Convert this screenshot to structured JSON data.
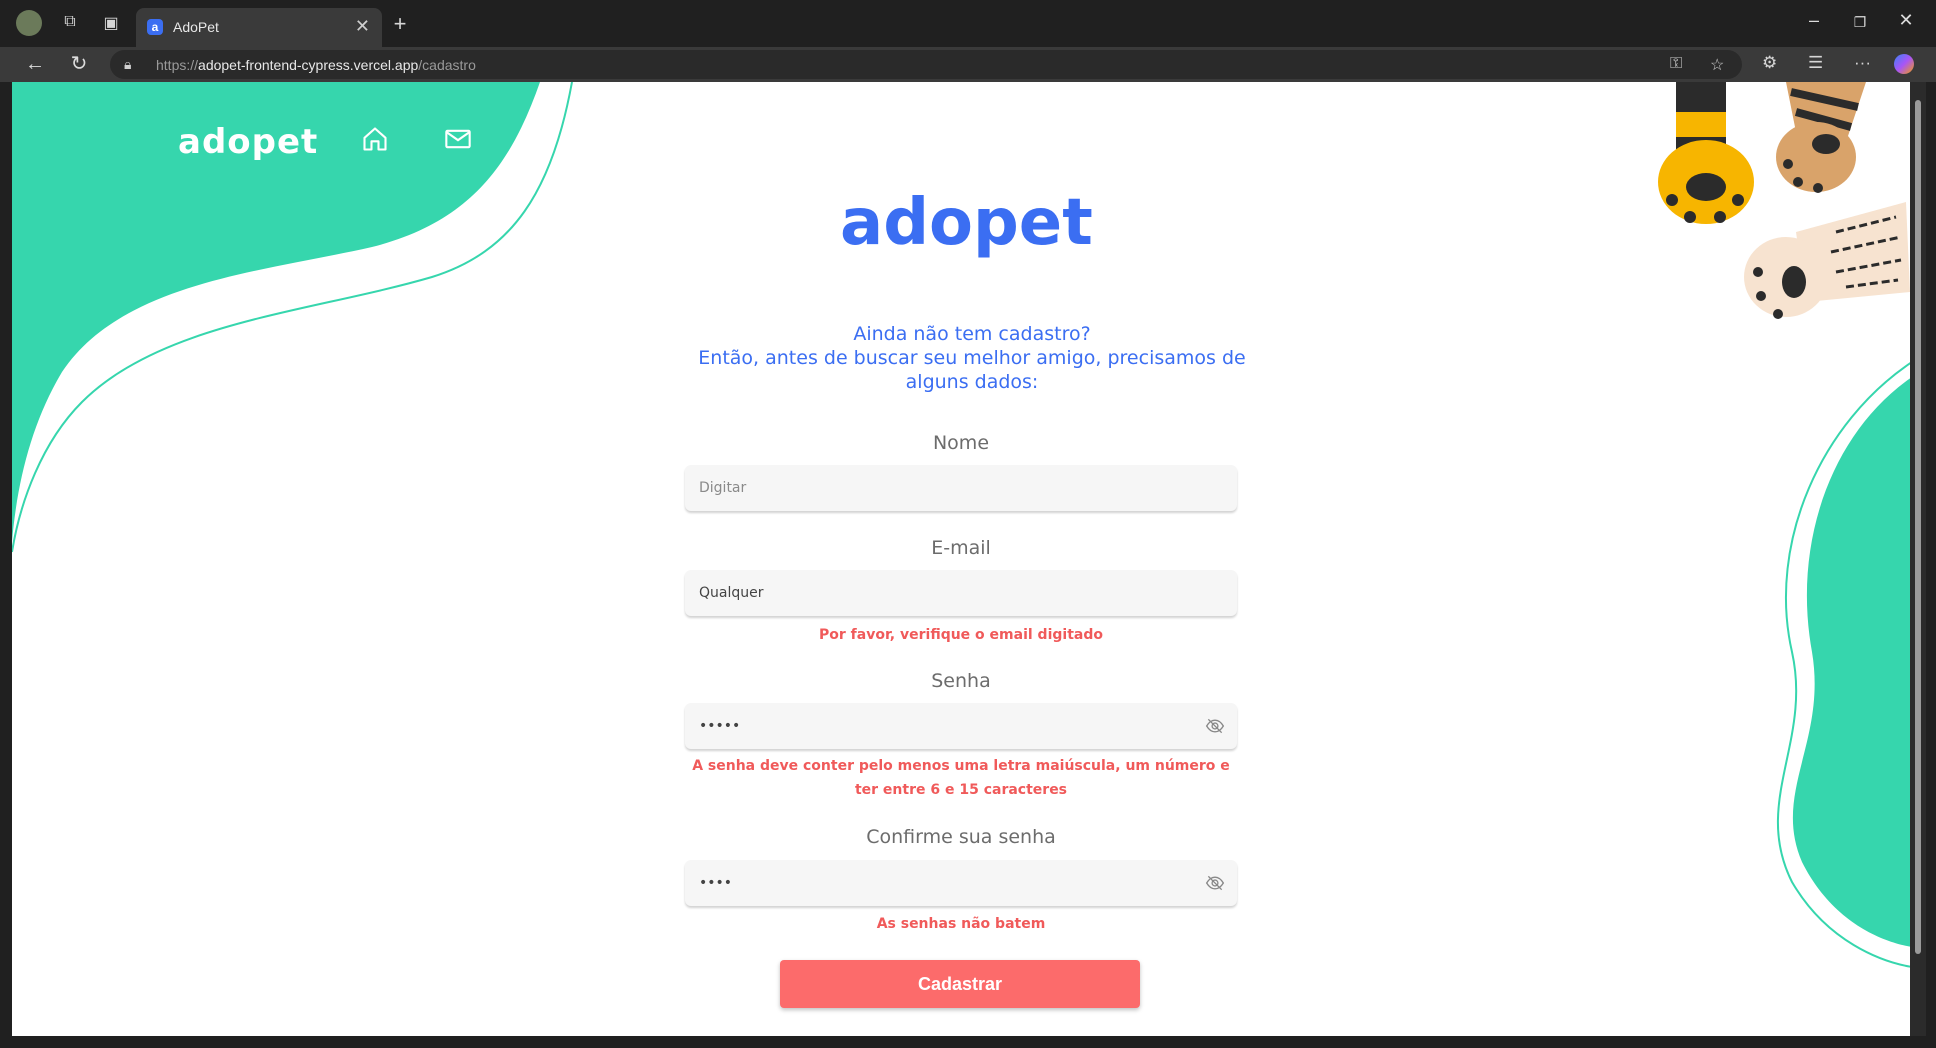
{
  "browser": {
    "tab_title": "AdoPet",
    "url_scheme": "https://",
    "url_host": "adopet-frontend-cypress.vercel.app",
    "url_path": "/cadastro"
  },
  "nav": {
    "logo": "adopet"
  },
  "main": {
    "logo": "adopet",
    "intro_line1": "Ainda não tem cadastro?",
    "intro_line2": "Então, antes de buscar seu melhor amigo, precisamos de alguns dados:"
  },
  "form": {
    "nome_label": "Nome",
    "nome_placeholder": "Digitar",
    "email_label": "E-mail",
    "email_value": "Qualquer",
    "email_error": "Por favor, verifique o email digitado",
    "senha_label": "Senha",
    "senha_value": "•••••",
    "senha_error": "A senha deve conter pelo menos uma letra maiúscula, um número e ter entre 6 e 15 caracteres",
    "confirm_label": "Confirme sua senha",
    "confirm_value": "••••",
    "confirm_error": "As senhas não batem",
    "submit_label": "Cadastrar"
  },
  "colors": {
    "accent_green": "#36D6AD",
    "brand_blue": "#3B6EF2",
    "error_red": "#F05A5A",
    "button_coral": "#FC6B6B"
  }
}
